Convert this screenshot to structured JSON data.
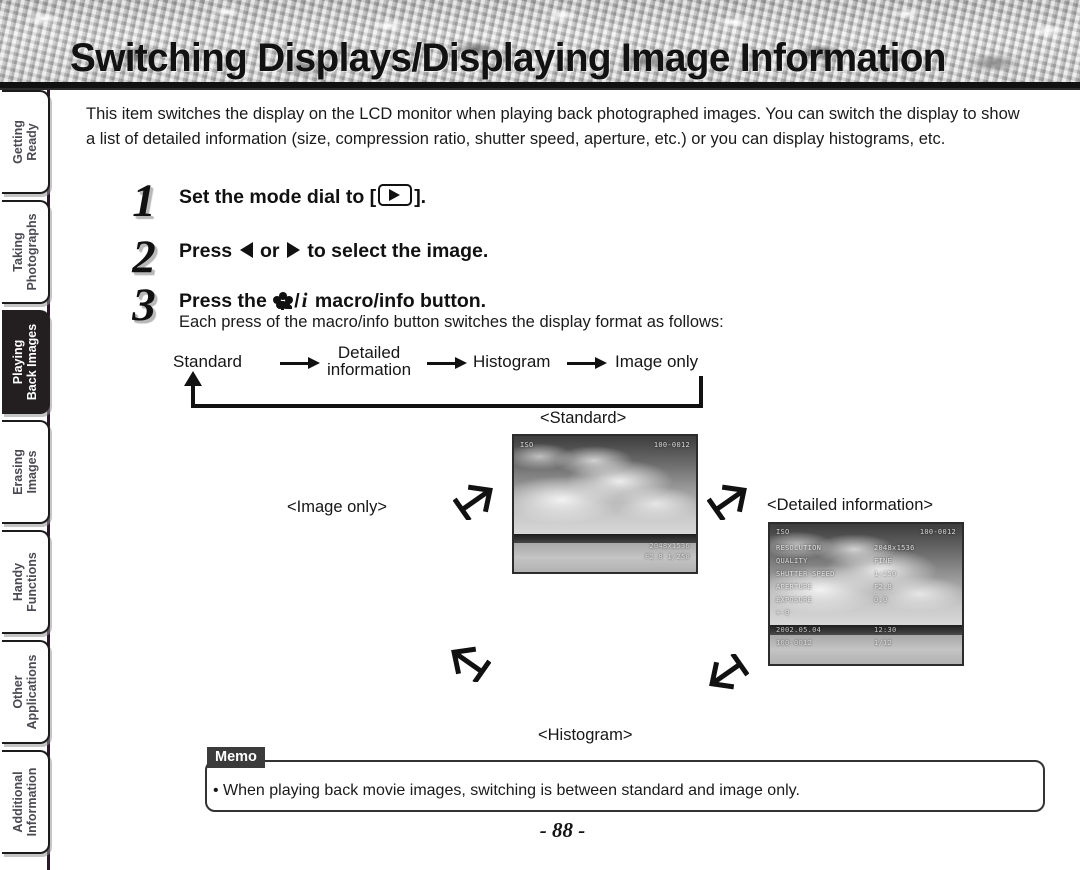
{
  "header": {
    "title": "Switching Displays/Displaying Image Information"
  },
  "sidebar": {
    "tabs": [
      {
        "label_line1": "Getting",
        "label_line2": "Ready",
        "active": false
      },
      {
        "label_line1": "Taking",
        "label_line2": "Photographs",
        "active": false
      },
      {
        "label_line1": "Playing",
        "label_line2": "Back Images",
        "active": true
      },
      {
        "label_line1": "Erasing",
        "label_line2": "Images",
        "active": false
      },
      {
        "label_line1": "Handy",
        "label_line2": "Functions",
        "active": false
      },
      {
        "label_line1": "Other",
        "label_line2": "Applications",
        "active": false
      },
      {
        "label_line1": "Additional",
        "label_line2": "Information",
        "active": false
      }
    ]
  },
  "main": {
    "intro": "This item switches the display on the LCD monitor when playing back photographed images. You can switch the display to show a list of detailed information (size, compression ratio, shutter speed, aperture, etc.) or you can display histograms, etc.",
    "steps": [
      {
        "number": "1",
        "text_before": "Set the mode dial to [",
        "text_after": "].",
        "icon": "playback-mode-icon"
      },
      {
        "number": "2",
        "text_before": "Press",
        "text_middle": "or",
        "text_after": "to select the image."
      },
      {
        "number": "3",
        "text_before": "Press the",
        "text_slash": "/",
        "text_after": "macro/info button.",
        "sub": "Each press of the macro/info button switches the display format as follows:"
      }
    ],
    "flow": {
      "items": [
        "Standard",
        "Detailed\ninformation",
        "Histogram",
        "Image only"
      ],
      "item1": "Standard",
      "item2_line1": "Detailed",
      "item2_line2": "information",
      "item3": "Histogram",
      "item4": "Image only"
    },
    "cycle_captions": {
      "standard": "<Standard>",
      "detailed": "<Detailed information>",
      "histogram": "<Histogram>",
      "image_only": "<Image only>"
    },
    "lcd_standard_osd": {
      "top_left": "ISO",
      "top_right": "100-0012",
      "bottom_right_1": "2048x1536",
      "bottom_right_2": "F2.8 1/250"
    },
    "lcd_detailed_osd": {
      "top_left": "ISO",
      "top_right": "100-0012",
      "row1_label": "RESOLUTION",
      "row1_value": "2048x1536",
      "row2_label": "QUALITY",
      "row2_value": "FINE",
      "row3_label": "SHUTTER SPEED",
      "row3_value": "1/250",
      "row4_label": "APERTURE",
      "row4_value": "F2.8",
      "row5_label": "EXPOSURE",
      "row5_value": "0.0",
      "row6_label": "+-0",
      "row7_label": "2002.05.04",
      "row7_value": "12:30",
      "row8_label": "100-0012",
      "row8_value": "1/12"
    },
    "memo": {
      "tag": "Memo",
      "bullet": "•",
      "text": "When playing back movie images, switching is between standard and image only."
    },
    "page_number": "- 88 -"
  },
  "colors": {
    "ink": "#111111",
    "active_tab_bg": "#231f20",
    "active_tab_fg": "#ffffff",
    "tab_fg": "#4a4a52",
    "memo_tag_bg": "#3b3b3b"
  }
}
